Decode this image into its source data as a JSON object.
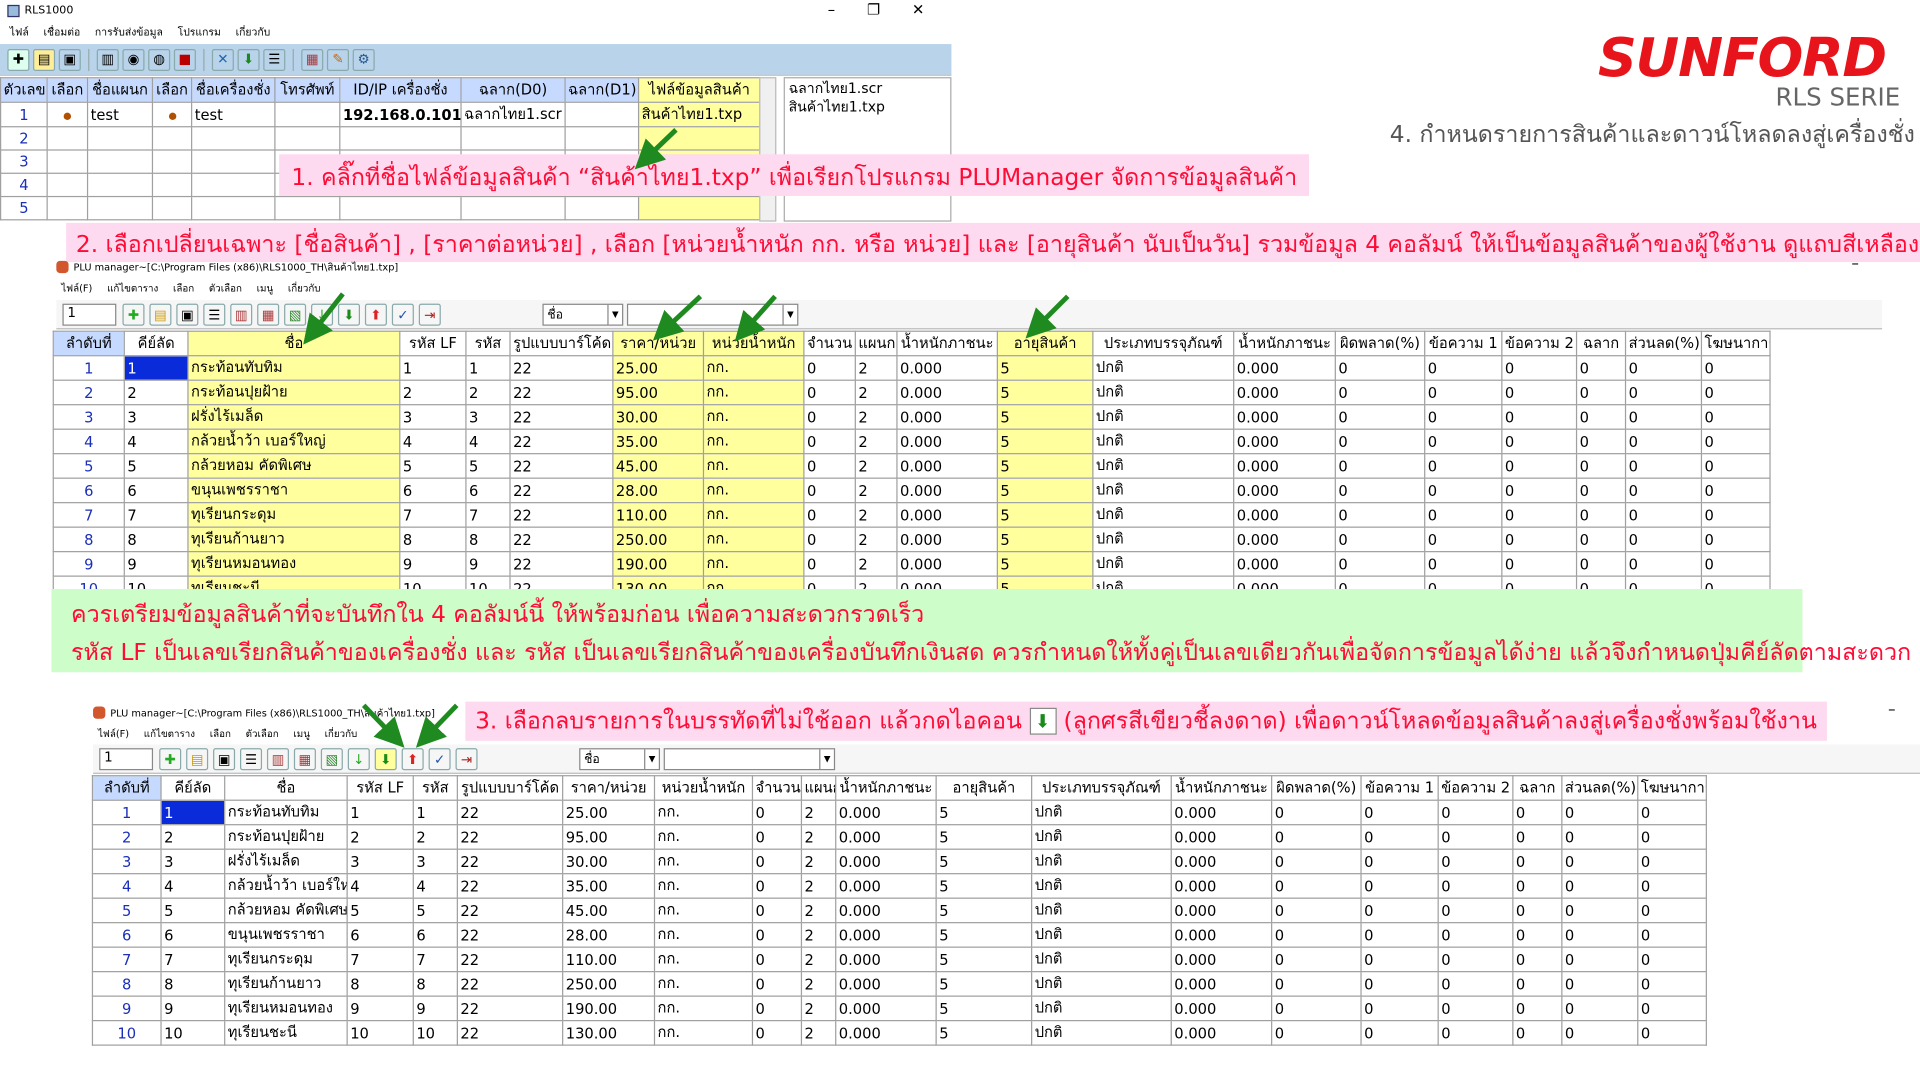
{
  "brand": {
    "name": "SUNFORD",
    "series": "RLS SERIE",
    "step_title": "4. กำหนดรายการสินค้าและดาวน์โหลดลงสู่เครื่องชั่ง",
    "color": "#e8141c"
  },
  "rls_window": {
    "title": "RLS1000",
    "menu": [
      "ไฟล์",
      "เชื่อมต่อ",
      "การรับส่งข้อมูล",
      "โปรแกรม",
      "เกี่ยวกับ"
    ],
    "controls": {
      "minimize": "–",
      "maximize": "❐",
      "close": "✕"
    },
    "columns": [
      "ตัวเลข",
      "เลือก",
      "ชื่อแผนก",
      "เลือก",
      "ชื่อเครื่องชั่ง",
      "โทรศัพท์",
      "ID/IP เครื่องชั่ง",
      "ฉลาก(D0)",
      "ฉลาก(D1)",
      "ไฟล์ข้อมูลสินค้า"
    ],
    "rows": [
      {
        "num": "1",
        "dept": "test",
        "scale_name": "test",
        "ip": "192.168.0.101",
        "label_d0": "ฉลากไทย1.scr",
        "file": "สินค้าไทย1.txp"
      },
      {
        "num": "2"
      },
      {
        "num": "3"
      },
      {
        "num": "4"
      },
      {
        "num": "5"
      }
    ],
    "side_list": [
      "ฉลากไทย1.scr",
      "สินค้าไทย1.txp"
    ]
  },
  "notes": {
    "note1": "1. คลิ๊กที่ชื่อไฟล์ข้อมูลสินค้า “สินค้าไทย1.txp” เพื่อเรียกโปรแกรม PLUManager จัดการข้อมูลสินค้า",
    "note2": "2. เลือกเปลี่ยนเฉพาะ [ชื่อสินค้า] , [ราคาต่อหน่วย] , เลือก [หน่วยน้ำหนัก กก. หรือ หน่วย] และ [อายุสินค้า นับเป็นวัน] รวมข้อมูล 4 คอลัมน์ ให้เป็นข้อมูลสินค้าของผู้ใช้งาน ดูแถบสีเหลือง",
    "green_line1": "ควรเตรียมข้อมูลสินค้าที่จะบันทึกใน 4 คอลัมน์นี้ ให้พร้อมก่อน เพื่อความสะดวกรวดเร็ว",
    "green_line2": "รหัส LF เป็นเลขเรียกสินค้าของเครื่องชั่ง และ รหัส เป็นเลขเรียกสินค้าของเครื่องบันทึกเงินสด ควรกำหนดให้ทั้งคู่เป็นเลขเดียวกันเพื่อจัดการข้อมูลได้ง่าย แล้วจึงกำหนดปุ่มคีย์ลัดตามสะดวก",
    "note3_pre": "3. เลือกลบรายการในบรรทัดที่ไม่ใช้ออก แล้วกดไอคอน",
    "note3_post": "(ลูกศรสีเขียวชี้ลงดาด) เพื่อดาวน์โหลดข้อมูลสินค้าลงสู่เครื่องชั่งพร้อมใช้งาน"
  },
  "plu1": {
    "title": "PLU manager~[C:\\Program Files (x86)\\RLS1000_TH\\สินค้าไทย1.txp]",
    "menu": [
      "ไฟล์(F)",
      "แก้ไขตาราง",
      "เลือก",
      "ตัวเลือก",
      "เมนู",
      "เกี่ยวกับ"
    ],
    "field": "1",
    "combo": "ชื่อ"
  },
  "plu2": {
    "title": "PLU manager~[C:\\Program Files (x86)\\RLS1000_TH\\สินค้าไทย1.txp]",
    "menu": [
      "ไฟล์(F)",
      "แก้ไขตาราง",
      "เลือก",
      "ตัวเลือก",
      "เมนู",
      "เกี่ยวกับ"
    ],
    "field": "1",
    "combo": "ชื่อ"
  },
  "plu_columns": [
    "ลำดับที่",
    "คีย์ลัด",
    "ชื่อ",
    "รหัส LF",
    "รหัส",
    "รูปแบบบาร์โค้ด",
    "ราคา/หน่วย",
    "หน่วยน้ำหนัก",
    "จำนวน",
    "แผนก",
    "น้ำหนักภาชนะ",
    "อายุสินค้า",
    "ประเภทบรรจุภัณฑ์",
    "น้ำหนักภาชนะ",
    "ผิดพลาด(%)",
    "ข้อความ 1",
    "ข้อความ 2",
    "ฉลาก",
    "ส่วนลด(%)",
    "โฆษนาการ"
  ],
  "plu_rows": [
    [
      "1",
      "1",
      "กระท้อนทับทิม",
      "1",
      "1",
      "22",
      "25.00",
      "กก.",
      "0",
      "2",
      "0.000",
      "5",
      "ปกติ",
      "0.000",
      "0",
      "0",
      "0",
      "0",
      "0",
      "0"
    ],
    [
      "2",
      "2",
      "กระท้อนปุยฝ้าย",
      "2",
      "2",
      "22",
      "95.00",
      "กก.",
      "0",
      "2",
      "0.000",
      "5",
      "ปกติ",
      "0.000",
      "0",
      "0",
      "0",
      "0",
      "0",
      "0"
    ],
    [
      "3",
      "3",
      "ฝรั่งไร้เมล็ด",
      "3",
      "3",
      "22",
      "30.00",
      "กก.",
      "0",
      "2",
      "0.000",
      "5",
      "ปกติ",
      "0.000",
      "0",
      "0",
      "0",
      "0",
      "0",
      "0"
    ],
    [
      "4",
      "4",
      "กล้วยน้ำว้า เบอร์ใหญ่",
      "4",
      "4",
      "22",
      "35.00",
      "กก.",
      "0",
      "2",
      "0.000",
      "5",
      "ปกติ",
      "0.000",
      "0",
      "0",
      "0",
      "0",
      "0",
      "0"
    ],
    [
      "5",
      "5",
      "กล้วยหอม คัดพิเศษ",
      "5",
      "5",
      "22",
      "45.00",
      "กก.",
      "0",
      "2",
      "0.000",
      "5",
      "ปกติ",
      "0.000",
      "0",
      "0",
      "0",
      "0",
      "0",
      "0"
    ],
    [
      "6",
      "6",
      "ขนุนเพชรราชา",
      "6",
      "6",
      "22",
      "28.00",
      "กก.",
      "0",
      "2",
      "0.000",
      "5",
      "ปกติ",
      "0.000",
      "0",
      "0",
      "0",
      "0",
      "0",
      "0"
    ],
    [
      "7",
      "7",
      "ทุเรียนกระดุม",
      "7",
      "7",
      "22",
      "110.00",
      "กก.",
      "0",
      "2",
      "0.000",
      "5",
      "ปกติ",
      "0.000",
      "0",
      "0",
      "0",
      "0",
      "0",
      "0"
    ],
    [
      "8",
      "8",
      "ทุเรียนก้านยาว",
      "8",
      "8",
      "22",
      "250.00",
      "กก.",
      "0",
      "2",
      "0.000",
      "5",
      "ปกติ",
      "0.000",
      "0",
      "0",
      "0",
      "0",
      "0",
      "0"
    ],
    [
      "9",
      "9",
      "ทุเรียนหมอนทอง",
      "9",
      "9",
      "22",
      "190.00",
      "กก.",
      "0",
      "2",
      "0.000",
      "5",
      "ปกติ",
      "0.000",
      "0",
      "0",
      "0",
      "0",
      "0",
      "0"
    ],
    [
      "10",
      "10",
      "ทุเรียนชะนี",
      "10",
      "10",
      "22",
      "130.00",
      "กก.",
      "0",
      "2",
      "0.000",
      "5",
      "ปกติ",
      "0.000",
      "0",
      "0",
      "0",
      "0",
      "0",
      "0"
    ]
  ]
}
